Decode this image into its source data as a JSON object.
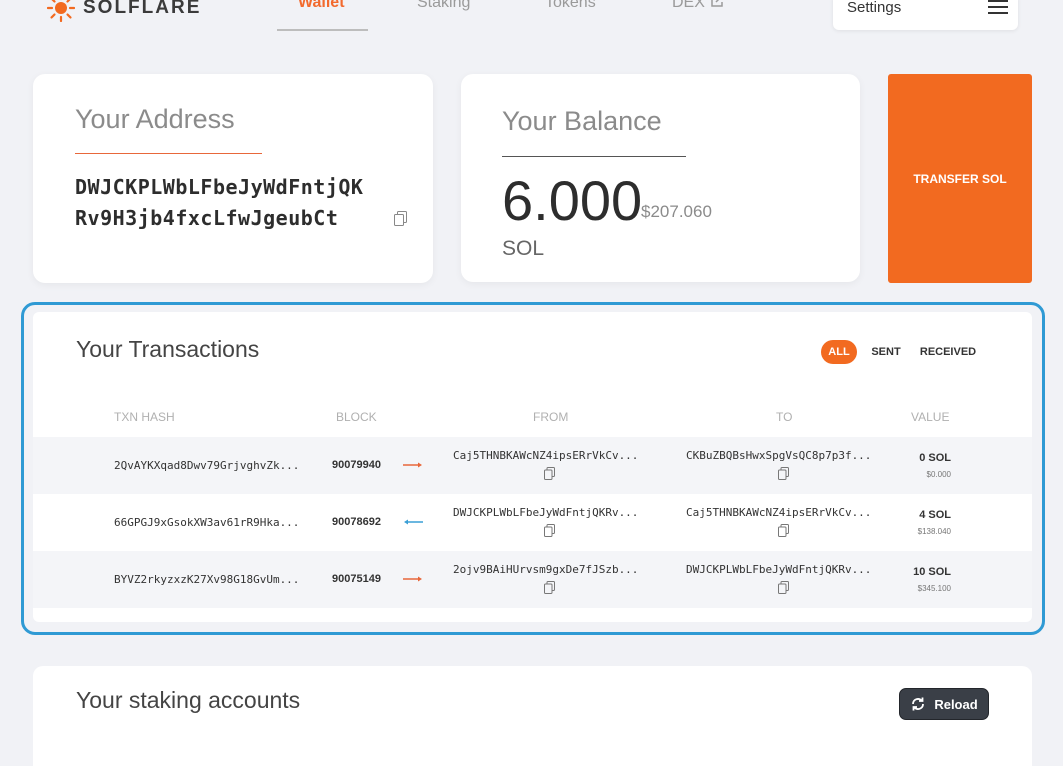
{
  "nav": {
    "logo_text": "SOLFLARE",
    "tabs": [
      "Wallet",
      "Staking",
      "Tokens",
      "DEX"
    ],
    "active_tab": "Wallet",
    "settings_label": "Settings"
  },
  "address": {
    "heading": "Your Address",
    "value": "DWJCKPLWbLFbeJyWdFntjQKRv9H3jb4fxcLfwJgeubCt"
  },
  "balance": {
    "heading": "Your Balance",
    "amount": "6.000",
    "usd": "$207.060",
    "unit": "SOL"
  },
  "transfer": {
    "label": "TRANSFER SOL"
  },
  "transactions": {
    "title": "Your Transactions",
    "filters": [
      "ALL",
      "SENT",
      "RECEIVED"
    ],
    "active_filter": "ALL",
    "columns": [
      "TXN HASH",
      "BLOCK",
      "FROM",
      "TO",
      "VALUE"
    ],
    "rows": [
      {
        "hash": "2QvAYKXqad8Dwv79GrjvghvZk...",
        "block": "90079940",
        "direction": "sent",
        "from": "Caj5THNBKAWcNZ4ipsERrVkCv...",
        "to": "CKBuZBQBsHwxSpgVsQC8p7p3f...",
        "value": "0 SOL",
        "usd": "$0.000"
      },
      {
        "hash": "66GPGJ9xGsokXW3av61rR9Hka...",
        "block": "90078692",
        "direction": "received",
        "from": "DWJCKPLWbLFbeJyWdFntjQKRv...",
        "to": "Caj5THNBKAWcNZ4ipsERrVkCv...",
        "value": "4 SOL",
        "usd": "$138.040"
      },
      {
        "hash": "BYVZ2rkyzxzK27Xv98G18GvUm...",
        "block": "90075149",
        "direction": "sent",
        "from": "2ojv9BAiHUrvsm9gxDe7fJSzb...",
        "to": "DWJCKPLWbLFbeJyWdFntjQKRv...",
        "value": "10 SOL",
        "usd": "$345.100"
      }
    ]
  },
  "staking": {
    "title": "Your staking accounts",
    "reload_label": "Reload"
  },
  "colors": {
    "accent": "#f26a20",
    "highlight_outline": "#2f9ad4",
    "sent_arrow": "#e8673a",
    "received_arrow": "#3a9fd6"
  }
}
